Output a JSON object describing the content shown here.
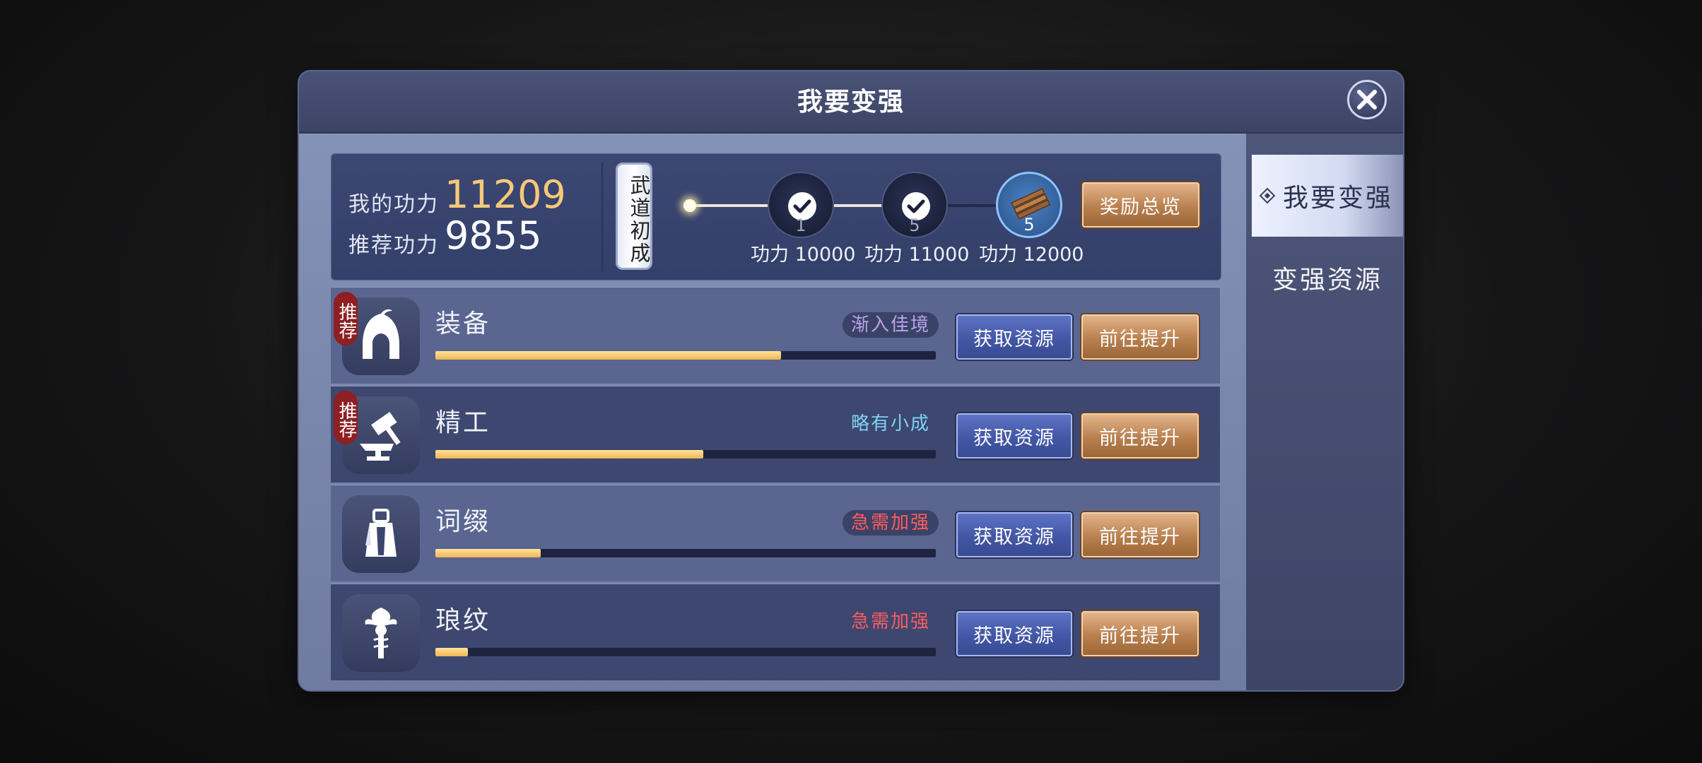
{
  "dialog": {
    "title": "我要变强"
  },
  "power": {
    "my_power_label": "我的功力",
    "my_power_value": "11209",
    "recommended_label": "推荐功力",
    "recommended_value": "9855"
  },
  "tier_badge": "武道初成",
  "milestones": [
    {
      "label": "功力",
      "value": "10000",
      "count": "1",
      "claimed": true
    },
    {
      "label": "功力",
      "value": "11000",
      "count": "5",
      "claimed": true
    },
    {
      "label": "功力",
      "value": "12000",
      "count": "5",
      "claimed": false
    }
  ],
  "reward_overview_button": "奖励总览",
  "categories": [
    {
      "name": "装备",
      "badge": "推荐",
      "status": "渐入佳境",
      "status_color": "#b9a3e8",
      "progress": 0.69,
      "get_button": "获取资源",
      "go_button": "前往提升"
    },
    {
      "name": "精工",
      "badge": "推荐",
      "status": "略有小成",
      "status_color": "#7fd3f3",
      "progress": 0.535,
      "get_button": "获取资源",
      "go_button": "前往提升"
    },
    {
      "name": "词缀",
      "badge": "",
      "status": "急需加强",
      "status_color": "#ff5c5c",
      "progress": 0.21,
      "get_button": "获取资源",
      "go_button": "前往提升"
    },
    {
      "name": "琅纹",
      "badge": "",
      "status": "急需加强",
      "status_color": "#ff5c5c",
      "progress": 0.065,
      "get_button": "获取资源",
      "go_button": "前往提升"
    }
  ],
  "nav": {
    "tab_strengthen": "我要变强",
    "tab_resources": "变强资源"
  },
  "colors": {
    "power_gold": "#f5c97a",
    "progress_fill": "#f2b650",
    "orange_button": "#b9804f",
    "blue_button": "#4257a6"
  }
}
